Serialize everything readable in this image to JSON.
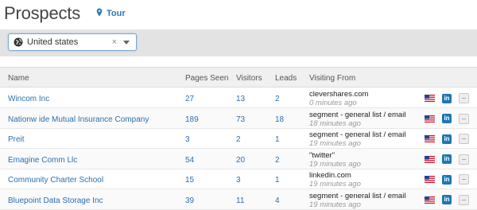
{
  "header": {
    "title": "Prospects",
    "tour_label": "Tour"
  },
  "filter": {
    "country_value": "United states",
    "clear_glyph": "×"
  },
  "table": {
    "columns": {
      "name": "Name",
      "pages_seen": "Pages Seen",
      "visitors": "Visitors",
      "leads": "Leads",
      "visiting_from": "Visiting From"
    },
    "rows": [
      {
        "name": "Wincom Inc",
        "pages_seen": "27",
        "visitors": "13",
        "leads": "2",
        "source": "clevershares.com",
        "time_ago": "0 minutes ago"
      },
      {
        "name": "Nationw ide Mutual Insurance Company",
        "pages_seen": "189",
        "visitors": "73",
        "leads": "18",
        "source": "segment - general list / email",
        "time_ago": "18 minutes ago"
      },
      {
        "name": "Preit",
        "pages_seen": "3",
        "visitors": "2",
        "leads": "1",
        "source": "segment - general list / email",
        "time_ago": "19 minutes ago"
      },
      {
        "name": "Emagine Comm Llc",
        "pages_seen": "54",
        "visitors": "20",
        "leads": "2",
        "source": "\"twitter\"",
        "time_ago": "19 minutes ago"
      },
      {
        "name": "Community Charter School",
        "pages_seen": "15",
        "visitors": "3",
        "leads": "1",
        "source": "linkedin.com",
        "time_ago": "19 minutes ago"
      },
      {
        "name": "Bluepoint Data Storage Inc",
        "pages_seen": "39",
        "visitors": "11",
        "leads": "4",
        "source": "segment - general list / email",
        "time_ago": "19 minutes ago"
      }
    ],
    "row_icons": {
      "linkedin_text": "in"
    }
  },
  "icons": {
    "tour": "map-pin-icon",
    "country": "globe-icon",
    "flag": "us-flag-icon",
    "linkedin": "linkedin-icon",
    "remove": "minus-icon"
  },
  "colors": {
    "link": "#2a6fb0",
    "linkedin": "#1b78b4",
    "filter_bar": "#e3e3e3"
  }
}
